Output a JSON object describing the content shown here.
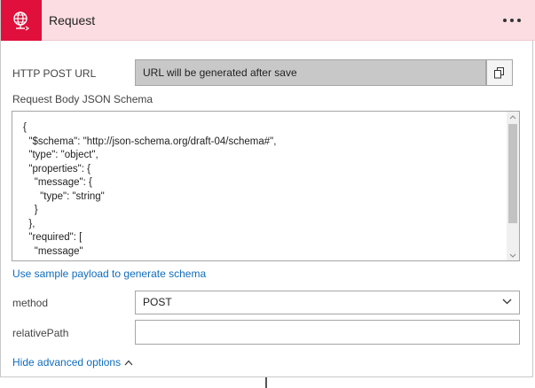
{
  "header": {
    "title": "Request",
    "icon": "globe-request-icon",
    "icon_bg": "#e10f3c",
    "bg": "#fbdde2"
  },
  "url": {
    "label": "HTTP POST URL",
    "value": "URL will be generated after save"
  },
  "schema": {
    "label": "Request Body JSON Schema",
    "text": "{\n  \"$schema\": \"http://json-schema.org/draft-04/schema#\",\n  \"type\": \"object\",\n  \"properties\": {\n    \"message\": {\n      \"type\": \"string\"\n    }\n  },\n  \"required\": [\n    \"message\""
  },
  "sample_link": "Use sample payload to generate schema",
  "method": {
    "label": "method",
    "value": "POST"
  },
  "relative_path": {
    "label": "relativePath",
    "value": "",
    "placeholder": ""
  },
  "advanced_link": "Hide advanced options",
  "link_color": "#0f6cbd"
}
